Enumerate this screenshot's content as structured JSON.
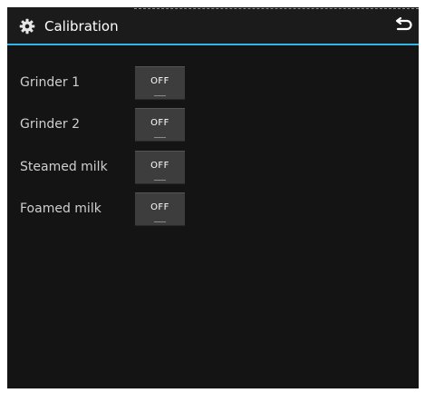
{
  "header": {
    "title": "Calibration",
    "icon": "gear-icon",
    "back_icon": "back-arrow-icon",
    "accent_color": "#33b5e5"
  },
  "settings": [
    {
      "label": "Grinder 1",
      "state": "OFF"
    },
    {
      "label": "Grinder 2",
      "state": "OFF"
    },
    {
      "label": "Steamed milk",
      "state": "OFF"
    },
    {
      "label": "Foamed milk",
      "state": "OFF"
    }
  ]
}
